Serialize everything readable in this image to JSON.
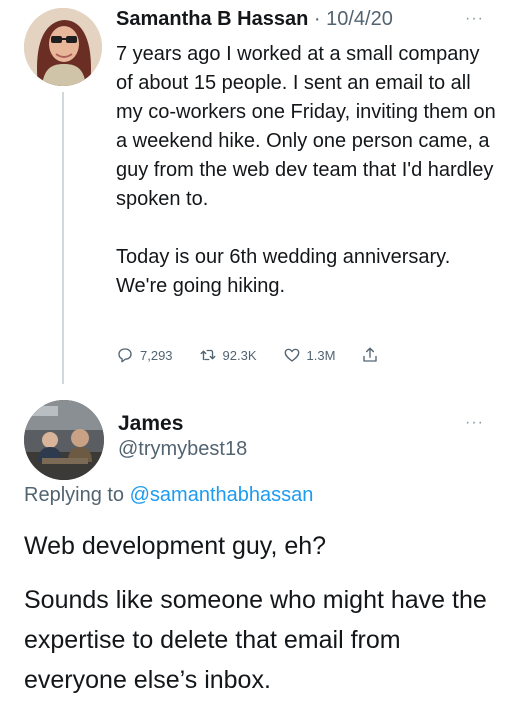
{
  "tweet": {
    "author": "Samantha B Hassan",
    "separator": "·",
    "date": "10/4/20",
    "more": "···",
    "paragraphs": [
      "7 years ago I worked at a small company of about 15 people. I sent an email to all my co-workers one Friday, inviting them on a weekend hike. Only one person came, a guy from the web dev team that I'd hardley spoken to.",
      "Today is our 6th wedding anniversary. We're going hiking."
    ],
    "stats": {
      "replies": "7,293",
      "retweets": "92.3K",
      "likes": "1.3M"
    },
    "icons": [
      "reply-icon",
      "retweet-icon",
      "like-icon",
      "share-icon"
    ]
  },
  "reply": {
    "name": "James",
    "handle": "@trymybest18",
    "more": "···",
    "replying_prefix": "Replying to",
    "replying_to": "@samanthabhassan",
    "paragraphs": [
      "Web development guy, eh?",
      "Sounds like someone who might have the expertise to delete that email from everyone else’s inbox."
    ]
  },
  "colors": {
    "text": "#14171a",
    "muted": "#536471",
    "link": "#1d9bf0"
  }
}
